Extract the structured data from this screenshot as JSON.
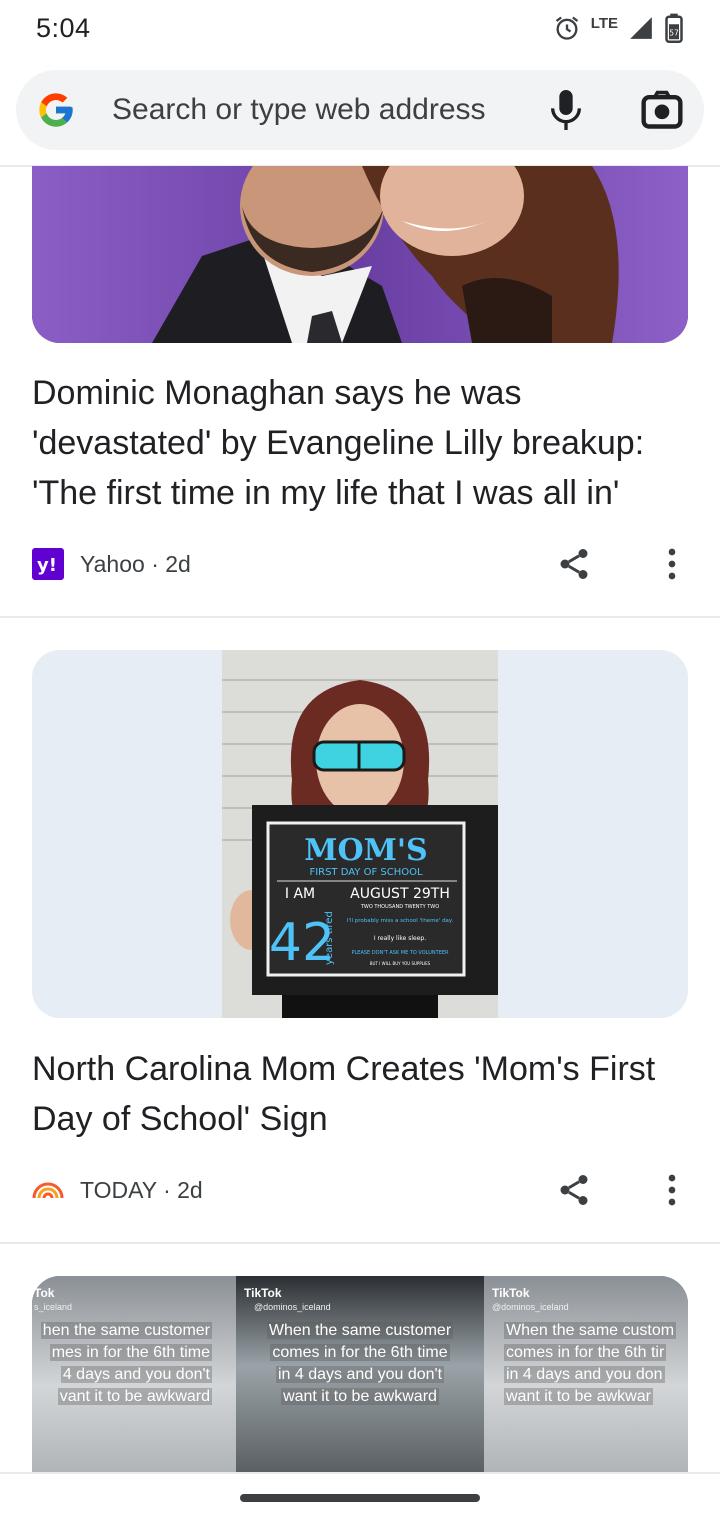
{
  "status_bar": {
    "time": "5:04",
    "network": "LTE",
    "battery_level": "57"
  },
  "search_bar": {
    "placeholder": "Search or type web address"
  },
  "articles": [
    {
      "title": "Dominic Monaghan says he was 'devastated' by Evangeline Lilly breakup: 'The first time in my life that I was all in'",
      "source": "Yahoo",
      "age": "2d",
      "meta": "Yahoo · 2d",
      "source_color": "#6001d2"
    },
    {
      "title": "North Carolina Mom Creates 'Mom's First Day of School' Sign",
      "source": "TODAY",
      "age": "2d",
      "meta": "TODAY · 2d",
      "source_color": "#f55a2c",
      "sign": {
        "heading": "MOM'S",
        "subheading": "FIRST DAY OF SCHOOL",
        "i_am": "I AM",
        "age": "42",
        "side_text": "years tired",
        "date": "AUGUST 29TH",
        "year": "TWO THOUSAND TWENTY TWO",
        "line1": "I'll probably miss a school 'theme' day.",
        "line2": "I really like sleep.",
        "line3": "PLEASE DON'T ASK ME TO VOLUNTEER",
        "line4": "BUT I WILL BUY YOU SUPPLIES"
      }
    },
    {
      "panels": [
        {
          "logo": "Tok",
          "handle": "s_iceland",
          "caption": [
            "hen the same customer",
            "mes in for the 6th time",
            "4 days and you don't",
            "vant it to be awkward"
          ]
        },
        {
          "logo": "TikTok",
          "handle": "@dominos_iceland",
          "caption": [
            "When the same customer",
            "comes in for the 6th time",
            "in 4 days and you don't",
            "want it to be awkward"
          ]
        },
        {
          "logo": "TikTok",
          "handle": "@dominos_iceland",
          "caption": [
            "When the same custom",
            "comes in for the 6th tir",
            "in 4 days and you don",
            "want it to be awkwar"
          ]
        }
      ]
    }
  ],
  "colors": {
    "accent": "#1a73e8",
    "divider": "#e8eaed",
    "text": "#202124"
  }
}
